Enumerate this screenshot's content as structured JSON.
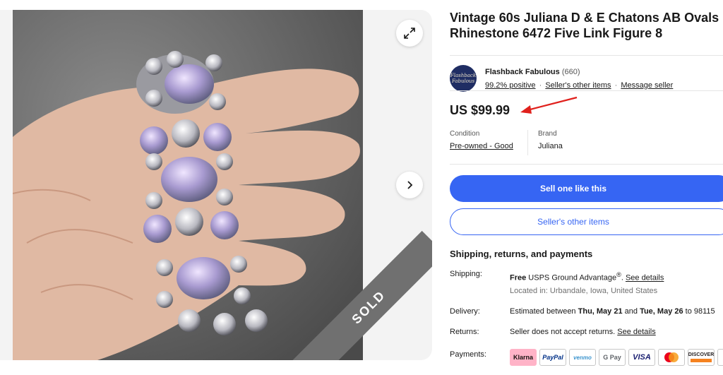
{
  "listing": {
    "title": "Vintage 60s Juliana D & E Chatons AB Ovals Rhinestone 6472 Five Link Figure 8",
    "sold_label": "SOLD"
  },
  "seller": {
    "logo_text": "Flashback Fabulous",
    "name": "Flashback Fabulous",
    "feedback_count": "(660)",
    "positive": "99.2% positive",
    "other_items": "Seller's other items",
    "message": "Message seller"
  },
  "price": "US $99.99",
  "condition": {
    "label": "Condition",
    "value": "Pre-owned - Good"
  },
  "brand": {
    "label": "Brand",
    "value": "Juliana"
  },
  "buttons": {
    "sell_one": "Sell one like this",
    "other_items": "Seller's other items"
  },
  "shipping": {
    "heading": "Shipping, returns, and payments",
    "shipping_label": "Shipping:",
    "shipping_free": "Free",
    "shipping_service": " USPS Ground Advantage",
    "shipping_reg": "®",
    "see_details": "See details",
    "location": "Located in: Urbandale, Iowa, United States",
    "delivery_label": "Delivery:",
    "delivery_pre": "Estimated between ",
    "delivery_start": "Thu, May 21",
    "delivery_and": " and ",
    "delivery_end": "Tue, May 26",
    "delivery_post": " to 98115",
    "returns_label": "Returns:",
    "returns_text": "Seller does not accept returns.",
    "returns_link": "See details",
    "payments_label": "Payments:"
  },
  "payments": {
    "klarna": "Klarna",
    "paypal": "PayPal",
    "venmo": "venmo",
    "gpay": "G Pay",
    "visa": "VISA",
    "discover": "DISCOVER"
  },
  "colors": {
    "primary": "#3665f3",
    "arrow": "#e0201c",
    "sold_ribbon": "#707070"
  }
}
